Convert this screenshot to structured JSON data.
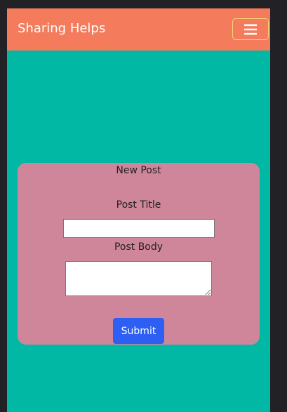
{
  "navbar": {
    "brand": "Sharing Helps",
    "toggle_icon": "hamburger-menu-icon",
    "background_color": "#f47b5c",
    "toggle_border_color": "#f1d37a"
  },
  "page": {
    "background_color": "#00b8a3"
  },
  "form": {
    "title": "New Post",
    "post_title_label": "Post Title",
    "post_title_value": "",
    "post_body_label": "Post Body",
    "post_body_value": "",
    "submit_label": "Submit",
    "card_color": "#cf869b",
    "submit_color": "#2e5ff5"
  }
}
